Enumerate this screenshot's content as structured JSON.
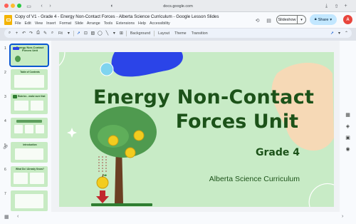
{
  "browser": {
    "url": "docs.google.com",
    "traffic_colors": [
      "#ff5f57",
      "#febc2e",
      "#28c840"
    ]
  },
  "app": {
    "doc_title": "Copy of V1 - Grade 4 - Energy Non-Contact Forces - Alberta Science Curriculum - Google Lesson Slides",
    "menu": [
      "File",
      "Edit",
      "View",
      "Insert",
      "Format",
      "Slide",
      "Arrange",
      "Tools",
      "Extensions",
      "Help",
      "Accessibility"
    ],
    "slideshow_label": "Slideshow",
    "share_label": "Share",
    "avatar_initial": "A"
  },
  "toolbar": {
    "zoom_label": "Fit",
    "background_label": "Background",
    "layout_label": "Layout",
    "theme_label": "Theme",
    "transition_label": "Transition"
  },
  "filmstrip": {
    "slides": [
      {
        "num": "1",
        "title": "Energy Non-Contact Forces Unit"
      },
      {
        "num": "2",
        "title": "Table of Contents"
      },
      {
        "num": "3",
        "title": "Rubrics - make sure that"
      },
      {
        "num": "4",
        "title": ""
      },
      {
        "num": "5",
        "title": "Introduction"
      },
      {
        "num": "6",
        "title": "What Do I Already Know?"
      },
      {
        "num": "7",
        "title": ""
      }
    ]
  },
  "slide": {
    "title_line1": "Energy Non-Contact",
    "title_line2": "Forces Unit",
    "grade": "Grade 4",
    "subtitle": "Alberta Science Curriculum"
  },
  "colors": {
    "slide_bg": "#c8ebc6",
    "title_green": "#1c5219",
    "accent_blue": "#2b44e8",
    "peach": "#f6d9b6",
    "tree_green": "#4f9a4f",
    "apple_yellow": "#f3cc1f",
    "arrow_red": "#c1272d",
    "selection_blue": "#0b57d0"
  }
}
